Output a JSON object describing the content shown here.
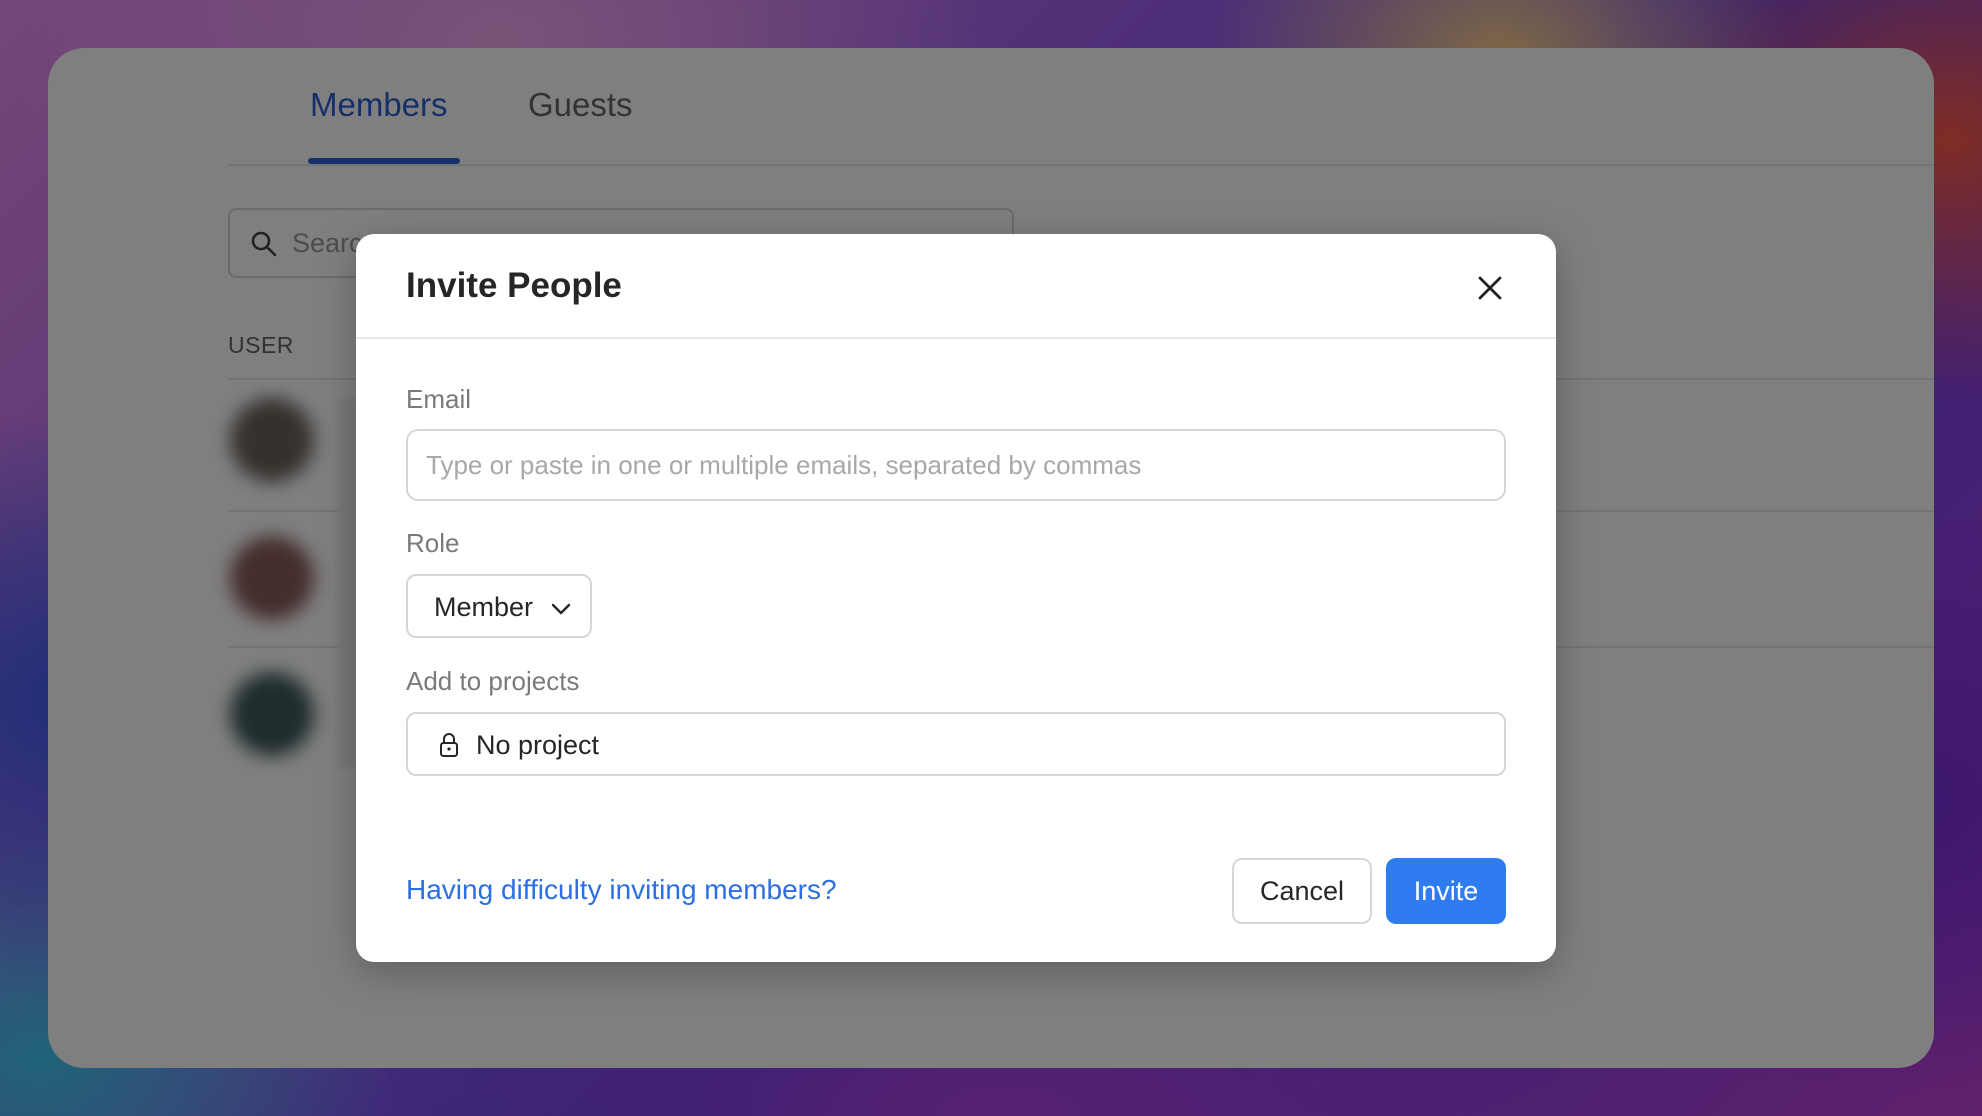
{
  "background_app": {
    "tabs": [
      {
        "label": "Members",
        "active": true
      },
      {
        "label": "Guests",
        "active": false
      }
    ],
    "search": {
      "placeholder": "Searc"
    },
    "table": {
      "column_user": "USER"
    }
  },
  "modal": {
    "title": "Invite People",
    "email": {
      "label": "Email",
      "placeholder": "Type or paste in one or multiple emails, separated by commas",
      "value": ""
    },
    "role": {
      "label": "Role",
      "selected": "Member"
    },
    "projects": {
      "label": "Add to projects",
      "selected": "No project"
    },
    "help_link": "Having difficulty inviting members?",
    "cancel_label": "Cancel",
    "invite_label": "Invite"
  },
  "colors": {
    "accent": "#2d5fd6",
    "primary_button": "#2f7cf0",
    "link": "#2d6fe0",
    "overlay": "rgba(0,0,0,0.5)"
  },
  "icons": [
    "search-icon",
    "close-icon",
    "chevron-down-icon",
    "lock-icon"
  ]
}
